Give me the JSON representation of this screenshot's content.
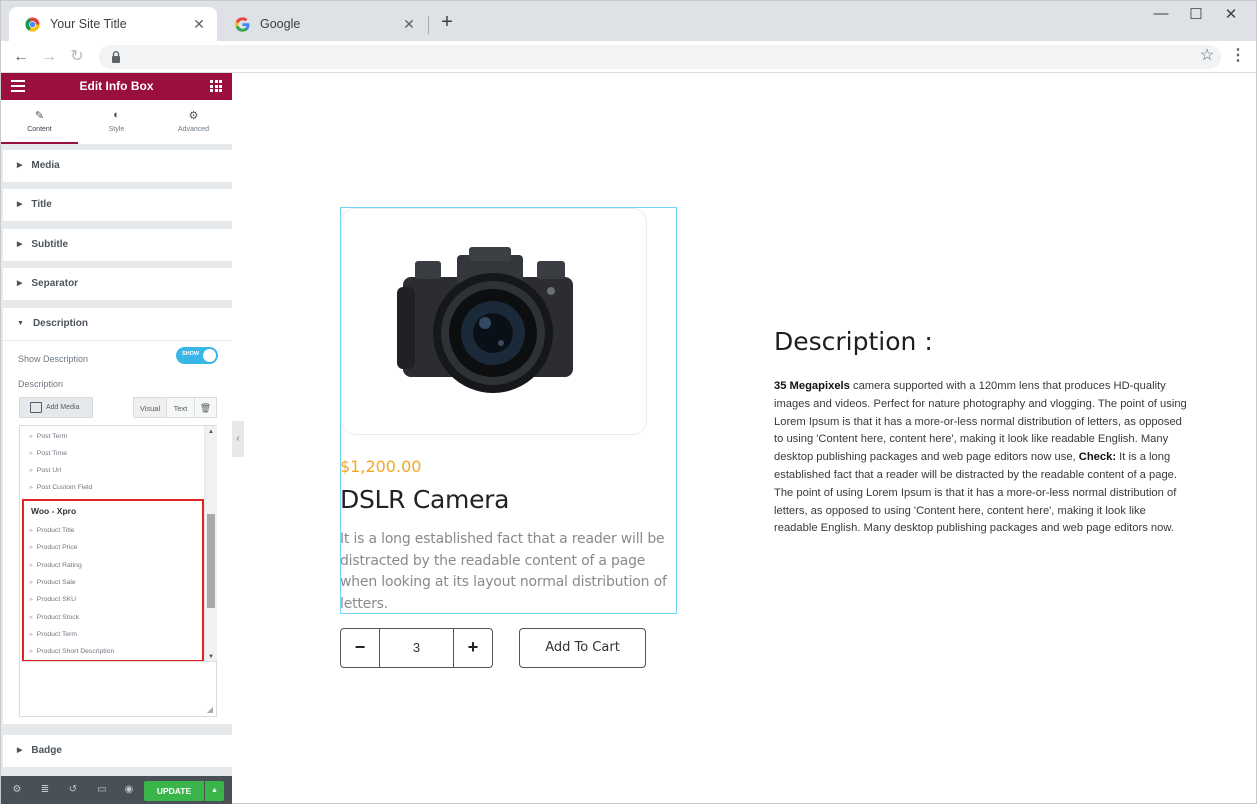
{
  "browser": {
    "tabs": [
      {
        "title": "Your Site Title",
        "favicon": "chrome-icon",
        "active": true
      },
      {
        "title": "Google",
        "favicon": "google-icon",
        "active": false
      }
    ],
    "new_tab": "+",
    "window_controls": {
      "minimize": "—",
      "maximize": "☐",
      "close": "✕"
    }
  },
  "panel": {
    "header": "Edit Info Box",
    "tabs": [
      {
        "label": "Content",
        "icon": "pencil-icon"
      },
      {
        "label": "Style",
        "icon": "contrast-icon"
      },
      {
        "label": "Advanced",
        "icon": "gear-icon"
      }
    ],
    "sections": [
      "Media",
      "Title",
      "Subtitle",
      "Separator",
      "Description",
      "Badge"
    ],
    "description": {
      "show_label": "Show Description",
      "toggle_text": "SHOW",
      "field_label": "Description",
      "add_media": "Add Media",
      "editor_tabs": [
        "Visual",
        "Text"
      ]
    },
    "dropdown": {
      "items_before": [
        "Post Term",
        "Post Time",
        "Post Url",
        "Post Custom Field"
      ],
      "group": "Woo - Xpro",
      "group_items": [
        "Product Title",
        "Product Price",
        "Product Rating",
        "Product Sale",
        "Product SKU",
        "Product Stock",
        "Product Term",
        "Product Short Description"
      ]
    },
    "footer": {
      "update": "UPDATE"
    },
    "accent_color": "#9a0f3d",
    "update_color": "#39b54a"
  },
  "product": {
    "price": "$1,200.00",
    "name": "DSLR Camera",
    "short_desc": "It is a long established fact that a reader will be distracted by the readable content of a page when looking at its layout normal distribution of letters.",
    "quantity": "3",
    "minus": "−",
    "plus": "+",
    "add_to_cart": "Add To Cart",
    "price_color": "#f5a623"
  },
  "description": {
    "heading": "Description :",
    "bold1": "35 Megapixels",
    "text1": " camera supported with a 120mm lens that produces HD-quality images and videos. Perfect for nature photography and vlogging. The point of using Lorem Ipsum is that it has a more-or-less normal distribution of letters, as opposed to using 'Content here, content here', making it look like readable English. Many desktop publishing packages and web page editors now use, ",
    "bold2": "Check:",
    "text2": " It is a long established fact that a reader will be distracted by the readable content of a page. The point of using Lorem Ipsum is that it has a more-or-less normal distribution of letters, as opposed to using 'Content here, content here', making it look like readable English. Many desktop publishing packages and web page editors now."
  }
}
